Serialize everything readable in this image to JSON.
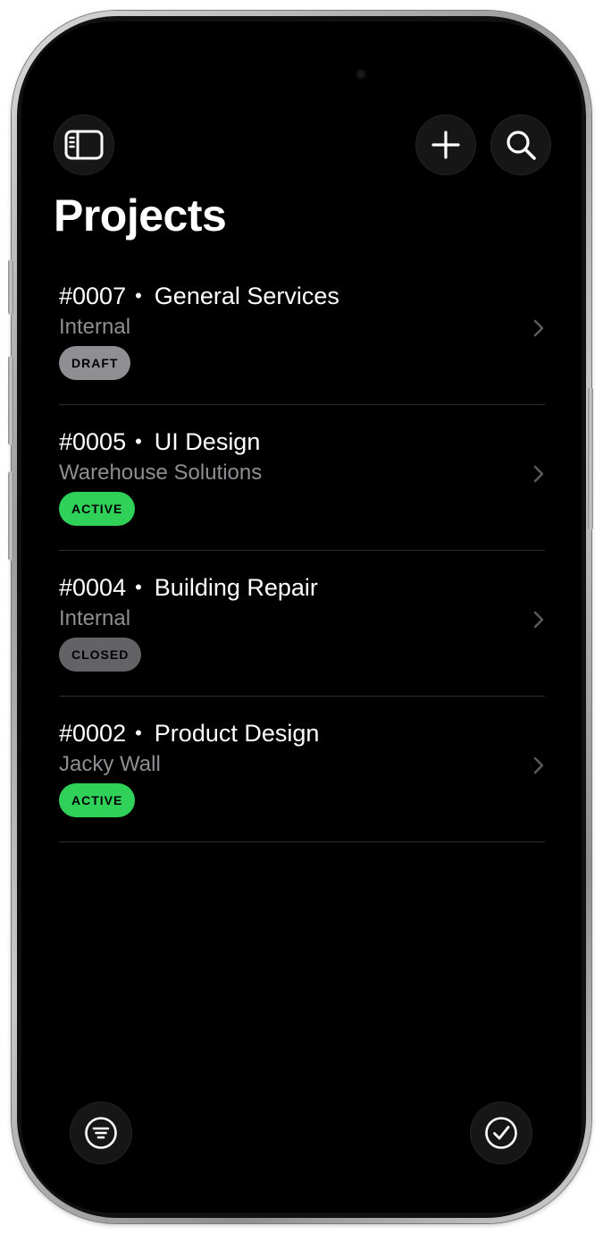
{
  "header": {
    "title": "Projects"
  },
  "toolbar": {
    "sidebar_icon": "sidebar-icon",
    "add_icon": "plus-icon",
    "search_icon": "search-icon",
    "filter_icon": "filter-icon",
    "select_icon": "checkmark-circle-icon"
  },
  "projects": [
    {
      "number": "#0007",
      "name": "General Services",
      "client": "Internal",
      "status": "DRAFT",
      "status_color": "#8e8e93"
    },
    {
      "number": "#0005",
      "name": "UI Design",
      "client": "Warehouse Solutions",
      "status": "ACTIVE",
      "status_color": "#30d158"
    },
    {
      "number": "#0004",
      "name": "Building Repair",
      "client": "Internal",
      "status": "CLOSED",
      "status_color": "#636366"
    },
    {
      "number": "#0002",
      "name": "Product Design",
      "client": "Jacky Wall",
      "status": "ACTIVE",
      "status_color": "#30d158"
    }
  ],
  "theme": {
    "background": "#000000",
    "separator": "#2c2c2e",
    "secondary_text": "#8e8e93"
  }
}
